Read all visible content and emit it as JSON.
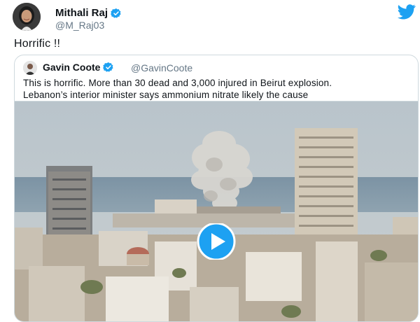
{
  "tweet": {
    "author_name": "Mithali Raj",
    "author_handle": "@M_Raj03",
    "text": "Horrific !!",
    "quoted": {
      "author_name": "Gavin Coote",
      "author_handle": "@GavinCoote",
      "text_line1": "This is horrific. More than 30 dead and 3,000 injured in Beirut explosion.",
      "text_line2": "Lebanon’s interior minister says ammonium nitrate likely the cause"
    }
  },
  "icons": {
    "brand": "twitter-bird-icon",
    "verified": "verified-badge-icon",
    "play": "play-icon"
  },
  "colors": {
    "twitter_blue": "#1da1f2",
    "text_primary": "#0f1419",
    "text_secondary": "#657786",
    "border": "#cfd9de"
  }
}
